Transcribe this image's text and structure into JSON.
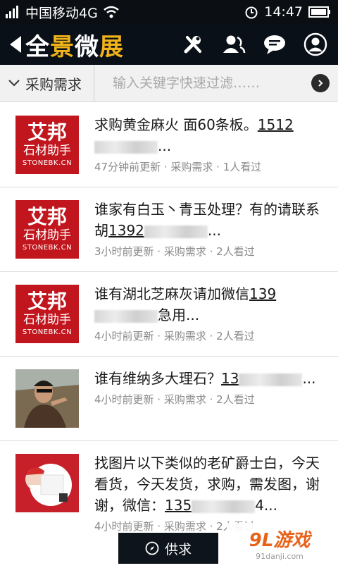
{
  "statusbar": {
    "carrier": "中国移动4G",
    "time": "14:47"
  },
  "header": {
    "brand_part1": "全",
    "brand_part2": "景",
    "brand_part3": "微",
    "brand_part4": "展"
  },
  "filter": {
    "category": "采购需求",
    "placeholder": "输入关键字快速过滤……"
  },
  "logo": {
    "line1": "艾邦",
    "line2": "石材助手",
    "line3": "STONEBK.CN"
  },
  "items": [
    {
      "title_a": "求购黄金麻火 面60条板。",
      "title_phone": "1512",
      "title_tail": "...",
      "meta": "47分钟前更新 · 采购需求 · 1人看过"
    },
    {
      "title_a": "谁家有白玉丶青玉处理？有的请联系胡",
      "title_phone": "1392",
      "title_tail": "...",
      "meta": "3小时前更新 · 采购需求 · 2人看过"
    },
    {
      "title_a": "谁有湖北芝麻灰请加微信",
      "title_phone": "139",
      "title_tail": "急用...",
      "meta": "4小时前更新 · 采购需求 · 2人看过"
    },
    {
      "title_a": "谁有维纳多大理石？",
      "title_phone": "13",
      "title_tail": "...",
      "meta": "4小时前更新 · 采购需求 · 2人看过"
    },
    {
      "title_a": "找图片以下类似的老矿爵士白，今天看货，今天发货，求购，需发图，谢谢，微信：",
      "title_phone": "135",
      "title_tail": "4...",
      "meta": "4小时前更新 · 采购需求 · 2人看过"
    }
  ],
  "bottom": {
    "tab_label": "供求"
  },
  "watermark": {
    "logo": "9L游戏",
    "url": "91danji.com"
  }
}
